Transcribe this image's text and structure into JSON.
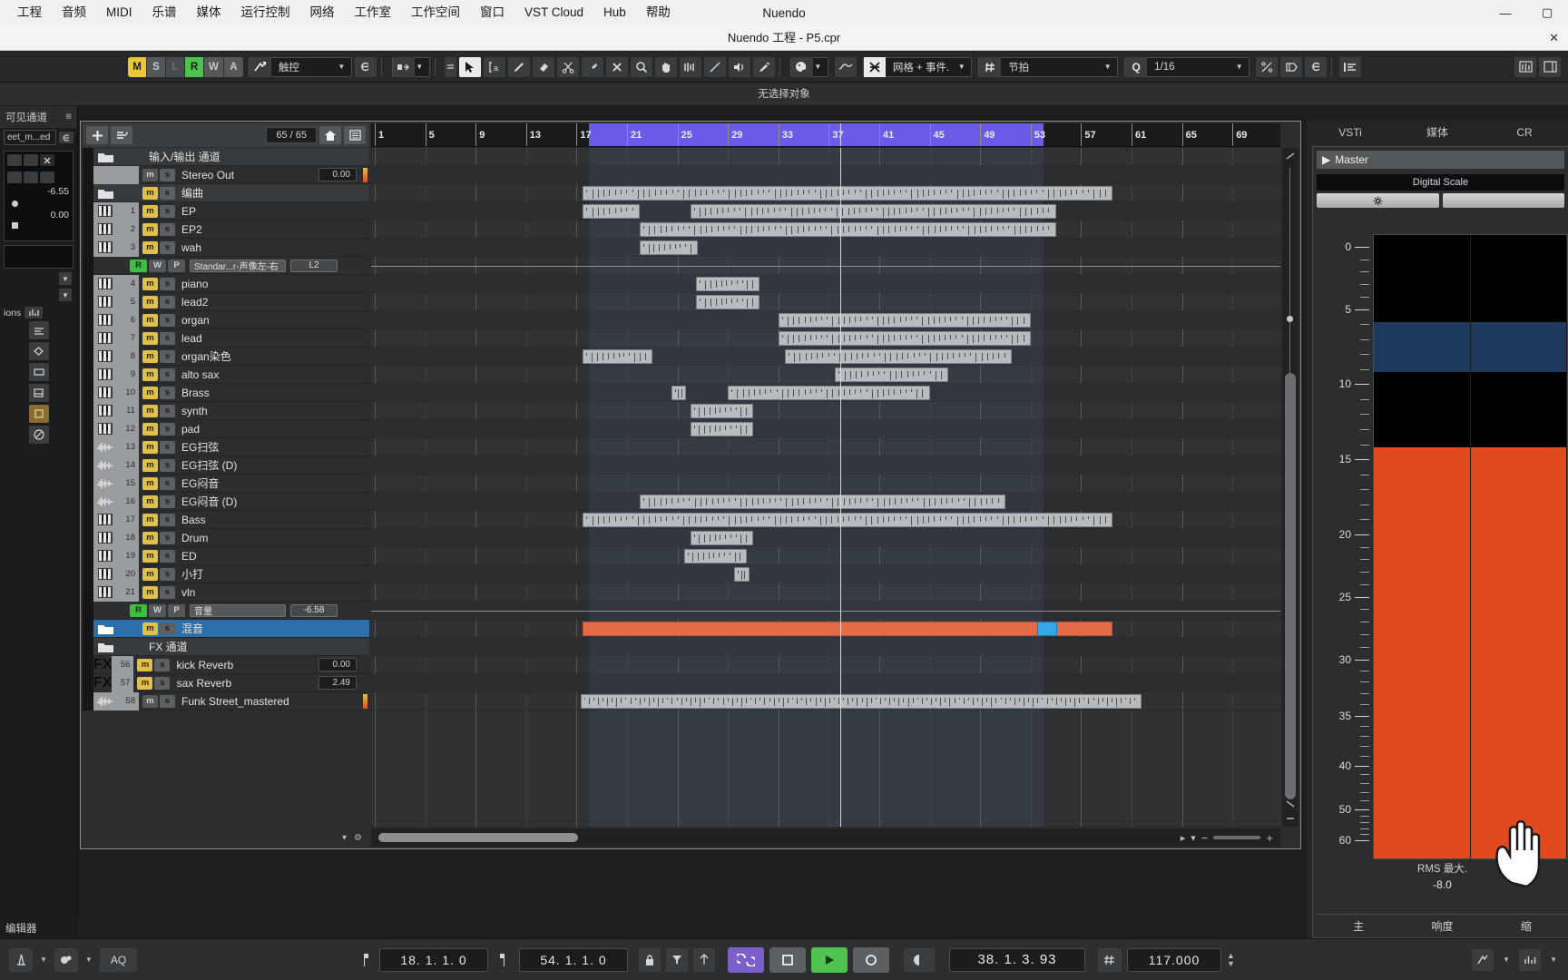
{
  "os": {
    "menu": [
      "工程",
      "音频",
      "MIDI",
      "乐谱",
      "媒体",
      "运行控制",
      "网络",
      "工作室",
      "工作空间",
      "窗口",
      "VST Cloud",
      "Hub",
      "帮助"
    ],
    "app_title": "Nuendo",
    "window_buttons": [
      "—",
      "▢",
      "✕"
    ]
  },
  "project_bar": {
    "title": "Nuendo 工程 - P5.cpr",
    "close": "✕"
  },
  "toolbar": {
    "automation_modes": [
      "M",
      "S",
      "L",
      "R",
      "W",
      "A"
    ],
    "touch_mode": "触控",
    "editor_label": "e",
    "snap_mode": "网格 + 事件.",
    "grid_type": "节拍",
    "quantize_icon": "Q",
    "quantize_value": "1/16"
  },
  "info_line": {
    "text": "无选择对象"
  },
  "left_strip": {
    "title": "可见通道",
    "channel_name": "eet_m...ed",
    "value_top": "-6.55",
    "value_bottom": "0.00",
    "ions_label": "ions",
    "footer": "编辑器"
  },
  "track_header": {
    "count": "65 / 65"
  },
  "tracks": [
    {
      "type": "folder",
      "name": "输入/输出 通道",
      "num": "",
      "mute": false,
      "value": ""
    },
    {
      "type": "out",
      "name": "Stereo Out",
      "num": "",
      "mute": false,
      "value": "0.00",
      "meter": true
    },
    {
      "type": "folder",
      "name": "编曲",
      "num": "",
      "mute": true,
      "value": ""
    },
    {
      "type": "midi",
      "name": "EP",
      "num": "1",
      "mute": true,
      "value": ""
    },
    {
      "type": "midi",
      "name": "EP2",
      "num": "2",
      "mute": true,
      "value": ""
    },
    {
      "type": "midi",
      "name": "wah",
      "num": "3",
      "mute": true,
      "value": ""
    },
    {
      "type": "auto",
      "name": "Standar...r-声像左-右",
      "num": "",
      "lane": "L2"
    },
    {
      "type": "midi",
      "name": "piano",
      "num": "4",
      "mute": true,
      "value": ""
    },
    {
      "type": "midi",
      "name": "lead2",
      "num": "5",
      "mute": true,
      "value": ""
    },
    {
      "type": "midi",
      "name": "organ",
      "num": "6",
      "mute": true,
      "value": ""
    },
    {
      "type": "midi",
      "name": "lead",
      "num": "7",
      "mute": true,
      "value": ""
    },
    {
      "type": "midi",
      "name": "organ染色",
      "num": "8",
      "mute": true,
      "value": ""
    },
    {
      "type": "midi",
      "name": "alto sax",
      "num": "9",
      "mute": true,
      "value": ""
    },
    {
      "type": "midi",
      "name": "Brass",
      "num": "10",
      "mute": true,
      "value": ""
    },
    {
      "type": "midi",
      "name": "synth",
      "num": "11",
      "mute": true,
      "value": ""
    },
    {
      "type": "midi",
      "name": "pad",
      "num": "12",
      "mute": true,
      "value": ""
    },
    {
      "type": "audio",
      "name": "EG扫弦",
      "num": "13",
      "mute": true,
      "value": ""
    },
    {
      "type": "audio",
      "name": "EG扫弦 (D)",
      "num": "14",
      "mute": true,
      "value": ""
    },
    {
      "type": "audio",
      "name": "EG闷音",
      "num": "15",
      "mute": true,
      "value": ""
    },
    {
      "type": "audio",
      "name": "EG闷音 (D)",
      "num": "16",
      "mute": true,
      "value": ""
    },
    {
      "type": "midi",
      "name": "Bass",
      "num": "17",
      "mute": true,
      "value": ""
    },
    {
      "type": "midi",
      "name": "Drum",
      "num": "18",
      "mute": true,
      "value": ""
    },
    {
      "type": "midi",
      "name": "ED",
      "num": "19",
      "mute": true,
      "value": ""
    },
    {
      "type": "midi",
      "name": "小打",
      "num": "20",
      "mute": true,
      "value": ""
    },
    {
      "type": "midi",
      "name": "vln",
      "num": "21",
      "mute": true,
      "value": ""
    },
    {
      "type": "auto",
      "name": "音量",
      "num": "",
      "lane": "-6.58"
    },
    {
      "type": "folder-sel",
      "name": "混音",
      "num": "",
      "mute": true,
      "value": ""
    },
    {
      "type": "folder",
      "name": "FX 通道",
      "num": "",
      "mute": false,
      "value": ""
    },
    {
      "type": "fx",
      "name": "kick Reverb",
      "num": "56",
      "mute": true,
      "value": "0.00"
    },
    {
      "type": "fx",
      "name": "sax Reverb",
      "num": "57",
      "mute": true,
      "value": "2.49"
    },
    {
      "type": "audio",
      "name": "Funk Street_mastered",
      "num": "58",
      "mute": false,
      "value": "",
      "meter": true
    }
  ],
  "automation_buttons": {
    "read": "R",
    "write": "W",
    "param": "P"
  },
  "ruler": {
    "bars": [
      "1",
      "5",
      "9",
      "13",
      "17",
      "21",
      "25",
      "29",
      "33",
      "37",
      "41",
      "45",
      "49",
      "53",
      "57",
      "61",
      "65",
      "69"
    ],
    "cycle_start_bar": 18,
    "cycle_end_bar": 54
  },
  "rack": {
    "tabs": [
      "VSTi",
      "媒体",
      "CR"
    ],
    "master_label": "Master",
    "scale_label": "Digital Scale",
    "meter_ticks": [
      "0",
      "5",
      "10",
      "15",
      "20",
      "25",
      "30",
      "35",
      "40",
      "50",
      "60"
    ],
    "rms_label": "RMS 最大.",
    "rms_value": "-8.0",
    "footer": [
      "主",
      "响度",
      "缩"
    ]
  },
  "transport": {
    "left_locator": "18. 1. 1. 0",
    "right_locator": "54. 1. 1. 0",
    "position": "38. 1. 3. 93",
    "tempo": "117.000",
    "aq_label": "AQ",
    "buttons": {
      "cycle": "cycle",
      "stop": "stop",
      "play": "play",
      "record": "record"
    }
  },
  "colors": {
    "cycle": "#6b5ce7",
    "mute": "#e0c049",
    "record": "#3fbf3f",
    "selected_event": "#e36b45",
    "selected_track": "#2d6fa8",
    "blue_event": "#35a6e8"
  },
  "arrangement_events": [
    {
      "lane": 2,
      "start": 17.5,
      "len": 42,
      "style": "normal"
    },
    {
      "lane": 3,
      "start": 17.5,
      "len": 4.5,
      "style": "normal"
    },
    {
      "lane": 3,
      "start": 26.0,
      "len": 29,
      "style": "normal"
    },
    {
      "lane": 4,
      "start": 22.0,
      "len": 33,
      "style": "normal"
    },
    {
      "lane": 5,
      "start": 22.0,
      "len": 4.6,
      "style": "normal"
    },
    {
      "lane": 7,
      "start": 26.5,
      "len": 5,
      "style": "normal"
    },
    {
      "lane": 8,
      "start": 26.5,
      "len": 5,
      "style": "normal"
    },
    {
      "lane": 9,
      "start": 33.0,
      "len": 20,
      "style": "normal"
    },
    {
      "lane": 10,
      "start": 33.0,
      "len": 20,
      "style": "normal"
    },
    {
      "lane": 11,
      "start": 17.5,
      "len": 5.5,
      "style": "normal"
    },
    {
      "lane": 11,
      "start": 33.5,
      "len": 18,
      "style": "normal"
    },
    {
      "lane": 12,
      "start": 37.5,
      "len": 9,
      "style": "normal"
    },
    {
      "lane": 13,
      "start": 24.5,
      "len": 1.2,
      "style": "normal"
    },
    {
      "lane": 13,
      "start": 29.0,
      "len": 16,
      "style": "normal"
    },
    {
      "lane": 14,
      "start": 26.0,
      "len": 5,
      "style": "normal"
    },
    {
      "lane": 15,
      "start": 26.0,
      "len": 5,
      "style": "normal"
    },
    {
      "lane": 19,
      "start": 22.0,
      "len": 29,
      "style": "normal"
    },
    {
      "lane": 20,
      "start": 17.5,
      "len": 42,
      "style": "normal"
    },
    {
      "lane": 21,
      "start": 26.0,
      "len": 5,
      "style": "normal"
    },
    {
      "lane": 22,
      "start": 25.5,
      "len": 5,
      "style": "normal"
    },
    {
      "lane": 23,
      "start": 29.5,
      "len": 1.2,
      "style": "normal"
    },
    {
      "lane": 26,
      "start": 17.5,
      "len": 42,
      "style": "selected"
    }
  ]
}
